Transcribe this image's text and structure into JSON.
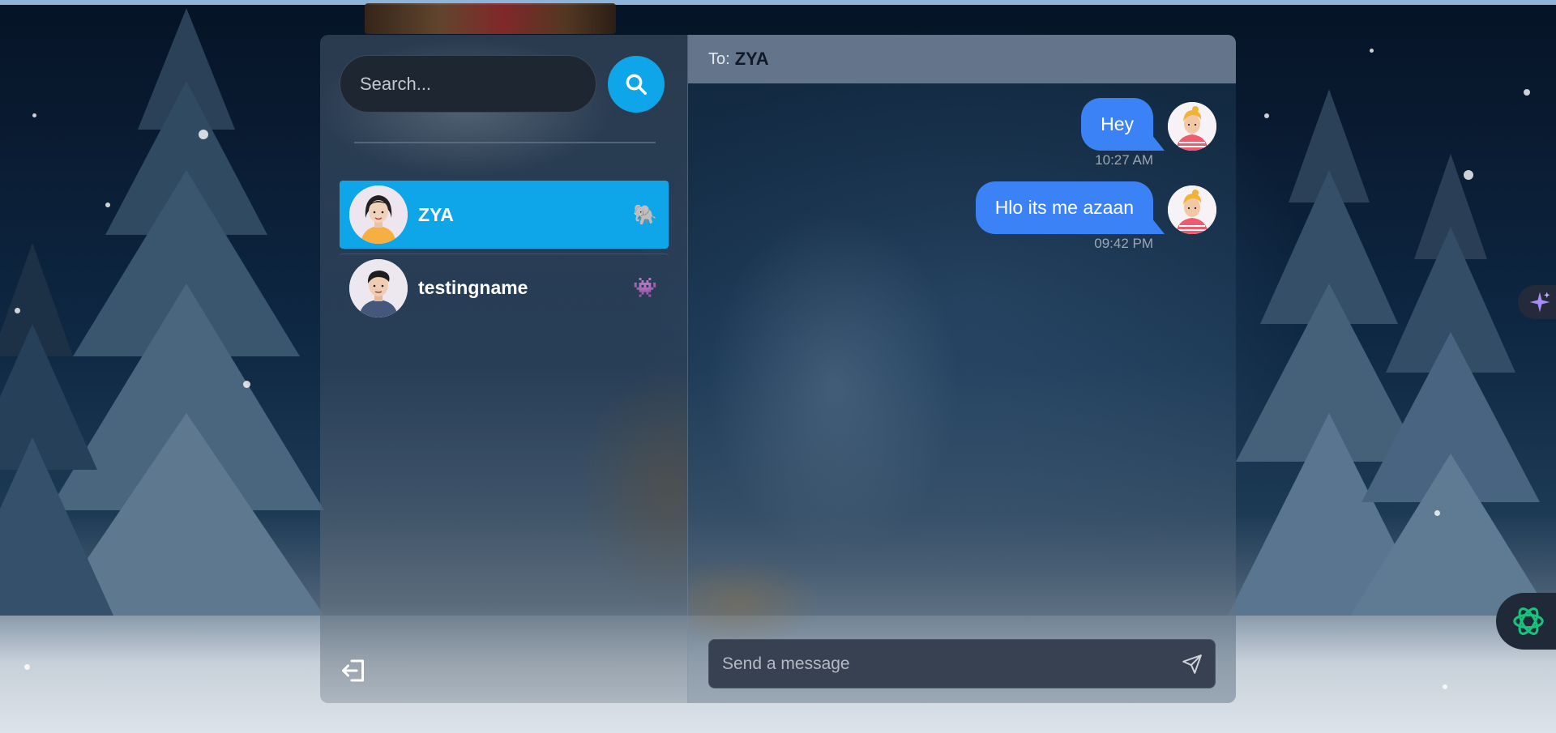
{
  "search": {
    "placeholder": "Search..."
  },
  "conversations": [
    {
      "name": "ZYA",
      "emoji": "🐘",
      "active": true,
      "avatar": "avatar-female"
    },
    {
      "name": "testingname",
      "emoji": "👾",
      "active": false,
      "avatar": "avatar-male"
    }
  ],
  "chat": {
    "to_label": "To:",
    "recipient": "ZYA",
    "messages": [
      {
        "text": "Hey",
        "time": "10:27 AM",
        "from_me": true
      },
      {
        "text": "Hlo its me azaan",
        "time": "09:42 PM",
        "from_me": true
      }
    ],
    "composer_placeholder": "Send a message"
  },
  "icons": {
    "search": "search-icon",
    "logout": "logout-icon",
    "send": "send-icon",
    "sparkle": "sparkle-icon",
    "assistant": "openai-icon"
  },
  "colors": {
    "accent": "#0ea5e9",
    "bubble": "#3b82f6",
    "header": "#64748b",
    "composer": "#374151"
  }
}
